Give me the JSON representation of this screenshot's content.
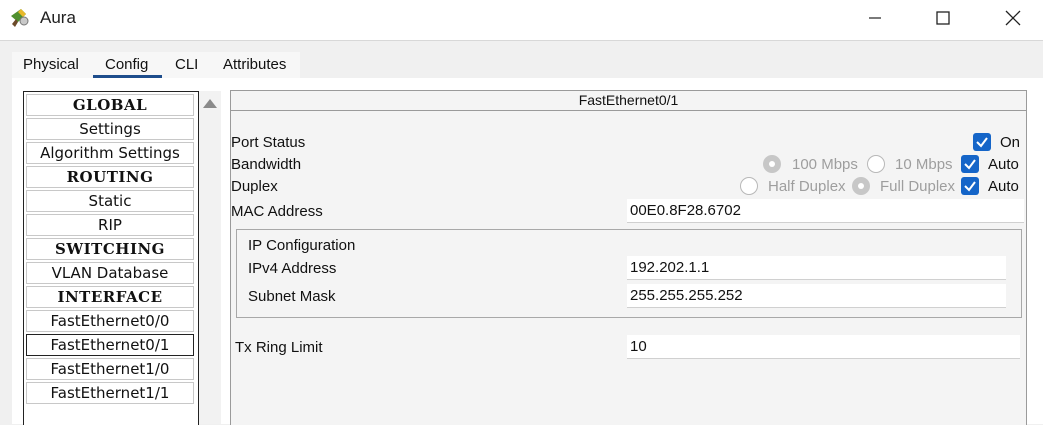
{
  "window": {
    "title": "Aura",
    "controls": [
      "minimize",
      "maximize",
      "close"
    ]
  },
  "tabs": [
    {
      "label": "Physical"
    },
    {
      "label": "Config"
    },
    {
      "label": "CLI"
    },
    {
      "label": "Attributes"
    }
  ],
  "active_tab": "Config",
  "sidebar": {
    "items": [
      {
        "label": "GLOBAL",
        "type": "header"
      },
      {
        "label": "Settings",
        "type": "item"
      },
      {
        "label": "Algorithm Settings",
        "type": "item"
      },
      {
        "label": "ROUTING",
        "type": "header"
      },
      {
        "label": "Static",
        "type": "item"
      },
      {
        "label": "RIP",
        "type": "item"
      },
      {
        "label": "SWITCHING",
        "type": "header"
      },
      {
        "label": "VLAN Database",
        "type": "item"
      },
      {
        "label": "INTERFACE",
        "type": "header"
      },
      {
        "label": "FastEthernet0/0",
        "type": "item"
      },
      {
        "label": "FastEthernet0/1",
        "type": "item",
        "selected": true
      },
      {
        "label": "FastEthernet1/0",
        "type": "item"
      },
      {
        "label": "FastEthernet1/1",
        "type": "item"
      }
    ]
  },
  "panel": {
    "title": "FastEthernet0/1",
    "port_status": {
      "label": "Port Status",
      "on_label": "On",
      "on_checked": true
    },
    "bandwidth": {
      "label": "Bandwidth",
      "opt_100": "100 Mbps",
      "opt_100_selected": true,
      "opt_10": "10 Mbps",
      "opt_10_selected": false,
      "auto_label": "Auto",
      "auto_checked": true
    },
    "duplex": {
      "label": "Duplex",
      "half": "Half Duplex",
      "half_selected": false,
      "full": "Full Duplex",
      "full_selected": true,
      "auto_label": "Auto",
      "auto_checked": true
    },
    "mac": {
      "label": "MAC Address",
      "value": "00E0.8F28.6702"
    },
    "ip_config": {
      "title": "IP Configuration",
      "ipv4_label": "IPv4 Address",
      "ipv4_value": "192.202.1.1",
      "mask_label": "Subnet Mask",
      "mask_value": "255.255.255.252"
    },
    "tx_ring": {
      "label": "Tx Ring Limit",
      "value": "10"
    }
  },
  "colors": {
    "accent": "#1565c8",
    "tab_underline": "#1e4d8c"
  }
}
